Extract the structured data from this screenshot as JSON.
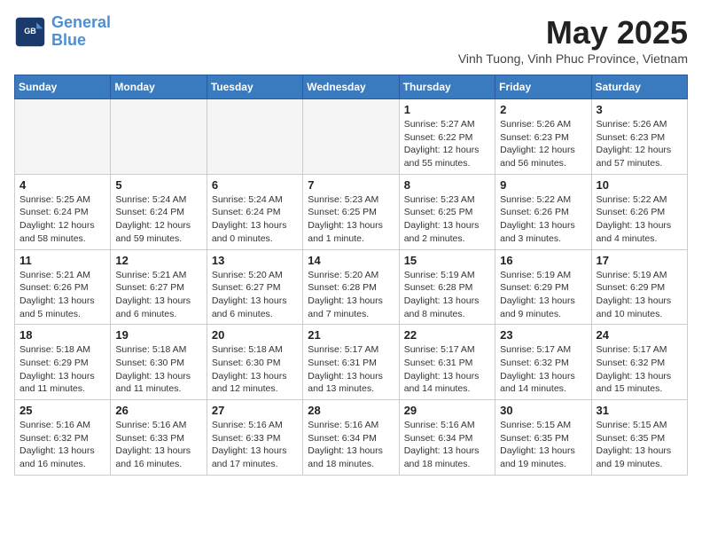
{
  "header": {
    "logo_line1": "General",
    "logo_line2": "Blue",
    "month": "May 2025",
    "location": "Vinh Tuong, Vinh Phuc Province, Vietnam"
  },
  "weekdays": [
    "Sunday",
    "Monday",
    "Tuesday",
    "Wednesday",
    "Thursday",
    "Friday",
    "Saturday"
  ],
  "weeks": [
    [
      {
        "day": "",
        "info": ""
      },
      {
        "day": "",
        "info": ""
      },
      {
        "day": "",
        "info": ""
      },
      {
        "day": "",
        "info": ""
      },
      {
        "day": "1",
        "info": "Sunrise: 5:27 AM\nSunset: 6:22 PM\nDaylight: 12 hours\nand 55 minutes."
      },
      {
        "day": "2",
        "info": "Sunrise: 5:26 AM\nSunset: 6:23 PM\nDaylight: 12 hours\nand 56 minutes."
      },
      {
        "day": "3",
        "info": "Sunrise: 5:26 AM\nSunset: 6:23 PM\nDaylight: 12 hours\nand 57 minutes."
      }
    ],
    [
      {
        "day": "4",
        "info": "Sunrise: 5:25 AM\nSunset: 6:24 PM\nDaylight: 12 hours\nand 58 minutes."
      },
      {
        "day": "5",
        "info": "Sunrise: 5:24 AM\nSunset: 6:24 PM\nDaylight: 12 hours\nand 59 minutes."
      },
      {
        "day": "6",
        "info": "Sunrise: 5:24 AM\nSunset: 6:24 PM\nDaylight: 13 hours\nand 0 minutes."
      },
      {
        "day": "7",
        "info": "Sunrise: 5:23 AM\nSunset: 6:25 PM\nDaylight: 13 hours\nand 1 minute."
      },
      {
        "day": "8",
        "info": "Sunrise: 5:23 AM\nSunset: 6:25 PM\nDaylight: 13 hours\nand 2 minutes."
      },
      {
        "day": "9",
        "info": "Sunrise: 5:22 AM\nSunset: 6:26 PM\nDaylight: 13 hours\nand 3 minutes."
      },
      {
        "day": "10",
        "info": "Sunrise: 5:22 AM\nSunset: 6:26 PM\nDaylight: 13 hours\nand 4 minutes."
      }
    ],
    [
      {
        "day": "11",
        "info": "Sunrise: 5:21 AM\nSunset: 6:26 PM\nDaylight: 13 hours\nand 5 minutes."
      },
      {
        "day": "12",
        "info": "Sunrise: 5:21 AM\nSunset: 6:27 PM\nDaylight: 13 hours\nand 6 minutes."
      },
      {
        "day": "13",
        "info": "Sunrise: 5:20 AM\nSunset: 6:27 PM\nDaylight: 13 hours\nand 6 minutes."
      },
      {
        "day": "14",
        "info": "Sunrise: 5:20 AM\nSunset: 6:28 PM\nDaylight: 13 hours\nand 7 minutes."
      },
      {
        "day": "15",
        "info": "Sunrise: 5:19 AM\nSunset: 6:28 PM\nDaylight: 13 hours\nand 8 minutes."
      },
      {
        "day": "16",
        "info": "Sunrise: 5:19 AM\nSunset: 6:29 PM\nDaylight: 13 hours\nand 9 minutes."
      },
      {
        "day": "17",
        "info": "Sunrise: 5:19 AM\nSunset: 6:29 PM\nDaylight: 13 hours\nand 10 minutes."
      }
    ],
    [
      {
        "day": "18",
        "info": "Sunrise: 5:18 AM\nSunset: 6:29 PM\nDaylight: 13 hours\nand 11 minutes."
      },
      {
        "day": "19",
        "info": "Sunrise: 5:18 AM\nSunset: 6:30 PM\nDaylight: 13 hours\nand 11 minutes."
      },
      {
        "day": "20",
        "info": "Sunrise: 5:18 AM\nSunset: 6:30 PM\nDaylight: 13 hours\nand 12 minutes."
      },
      {
        "day": "21",
        "info": "Sunrise: 5:17 AM\nSunset: 6:31 PM\nDaylight: 13 hours\nand 13 minutes."
      },
      {
        "day": "22",
        "info": "Sunrise: 5:17 AM\nSunset: 6:31 PM\nDaylight: 13 hours\nand 14 minutes."
      },
      {
        "day": "23",
        "info": "Sunrise: 5:17 AM\nSunset: 6:32 PM\nDaylight: 13 hours\nand 14 minutes."
      },
      {
        "day": "24",
        "info": "Sunrise: 5:17 AM\nSunset: 6:32 PM\nDaylight: 13 hours\nand 15 minutes."
      }
    ],
    [
      {
        "day": "25",
        "info": "Sunrise: 5:16 AM\nSunset: 6:32 PM\nDaylight: 13 hours\nand 16 minutes."
      },
      {
        "day": "26",
        "info": "Sunrise: 5:16 AM\nSunset: 6:33 PM\nDaylight: 13 hours\nand 16 minutes."
      },
      {
        "day": "27",
        "info": "Sunrise: 5:16 AM\nSunset: 6:33 PM\nDaylight: 13 hours\nand 17 minutes."
      },
      {
        "day": "28",
        "info": "Sunrise: 5:16 AM\nSunset: 6:34 PM\nDaylight: 13 hours\nand 18 minutes."
      },
      {
        "day": "29",
        "info": "Sunrise: 5:16 AM\nSunset: 6:34 PM\nDaylight: 13 hours\nand 18 minutes."
      },
      {
        "day": "30",
        "info": "Sunrise: 5:15 AM\nSunset: 6:35 PM\nDaylight: 13 hours\nand 19 minutes."
      },
      {
        "day": "31",
        "info": "Sunrise: 5:15 AM\nSunset: 6:35 PM\nDaylight: 13 hours\nand 19 minutes."
      }
    ]
  ]
}
